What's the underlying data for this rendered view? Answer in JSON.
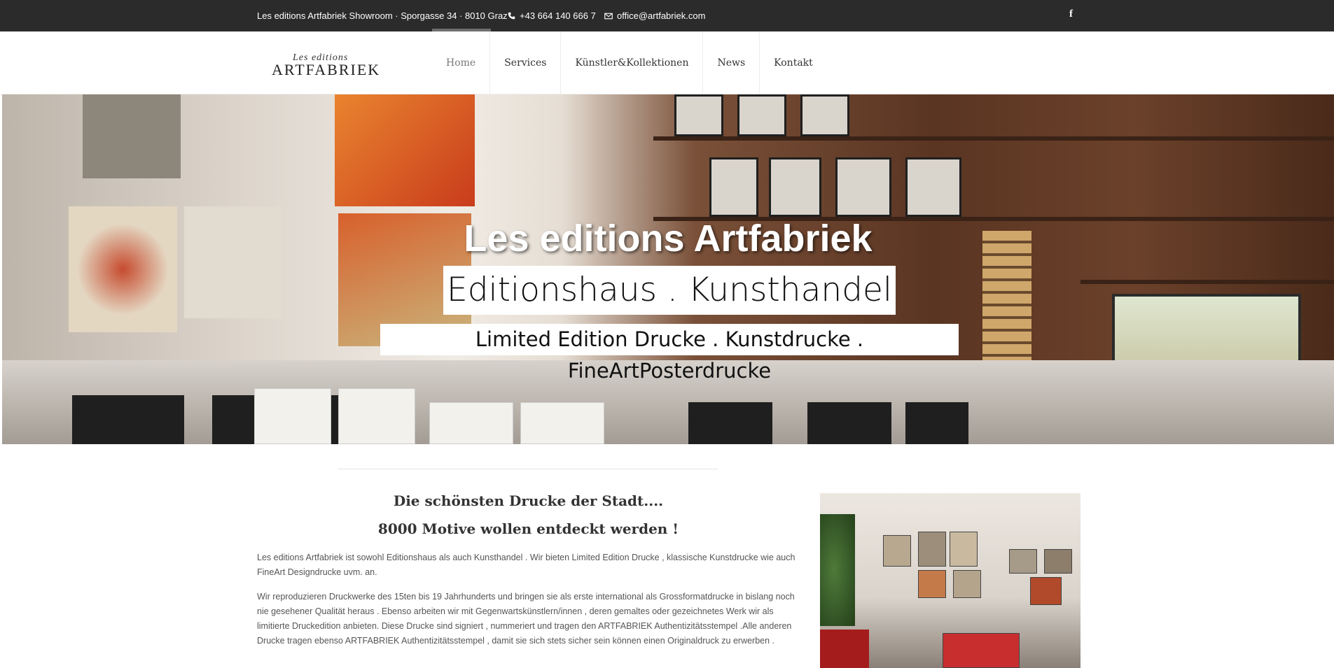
{
  "topbar": {
    "info": "Les editions Artfabriek Showroom · Sporgasse 34 · 8010 Graz",
    "phone_icon": "phone-icon",
    "phone": "+43 664 140 666 7",
    "mail_icon": "envelope-icon",
    "email": "office@artfabriek.com",
    "facebook_icon": "facebook-icon",
    "facebook_glyph": "f"
  },
  "logo": {
    "script": "Les editions",
    "main": "ARTFABRIEK"
  },
  "nav": {
    "items": [
      {
        "label": "Home"
      },
      {
        "label": "Services"
      },
      {
        "label": "Künstler&Kollektionen"
      },
      {
        "label": "News"
      },
      {
        "label": "Kontakt"
      }
    ],
    "active_index": 0
  },
  "hero": {
    "title": "Les editions Artfabriek",
    "subtitle": "Editionshaus . Kunsthandel",
    "tagline": "Limited Edition Drucke . Kunstdrucke . FineArtPosterdrucke"
  },
  "content": {
    "heading1": "Die schönsten Drucke der Stadt....",
    "heading2": "8000 Motive wollen entdeckt werden !",
    "paragraph1": "Les editions Artfabriek ist sowohl Editionshaus als  auch Kunsthandel . Wir bieten Limited Edition Drucke , klassische Kunstdrucke wie auch FineArt Designdrucke uvm. an.",
    "paragraph2": "Wir reproduzieren Druckwerke des 15ten bis 19 Jahrhunderts und bringen sie als erste international als Grossformatdrucke in bislang noch nie gesehener Qualität heraus . Ebenso arbeiten wir mit Gegenwartskünstlern/innen , deren gemaltes oder gezeichnetes Werk wir als limitierte Druckedition anbieten. Diese Drucke sind signiert , nummeriert und tragen den ARTFABRIEK Authentizitätsstempel .Alle anderen Drucke tragen ebenso ARTFABRIEK Authentizitätsstempel , damit sie sich stets sicher sein können einen Originaldruck zu erwerben ."
  },
  "colors": {
    "topbar_bg": "#2b2b2b",
    "text": "#555555",
    "heading": "#333333"
  }
}
